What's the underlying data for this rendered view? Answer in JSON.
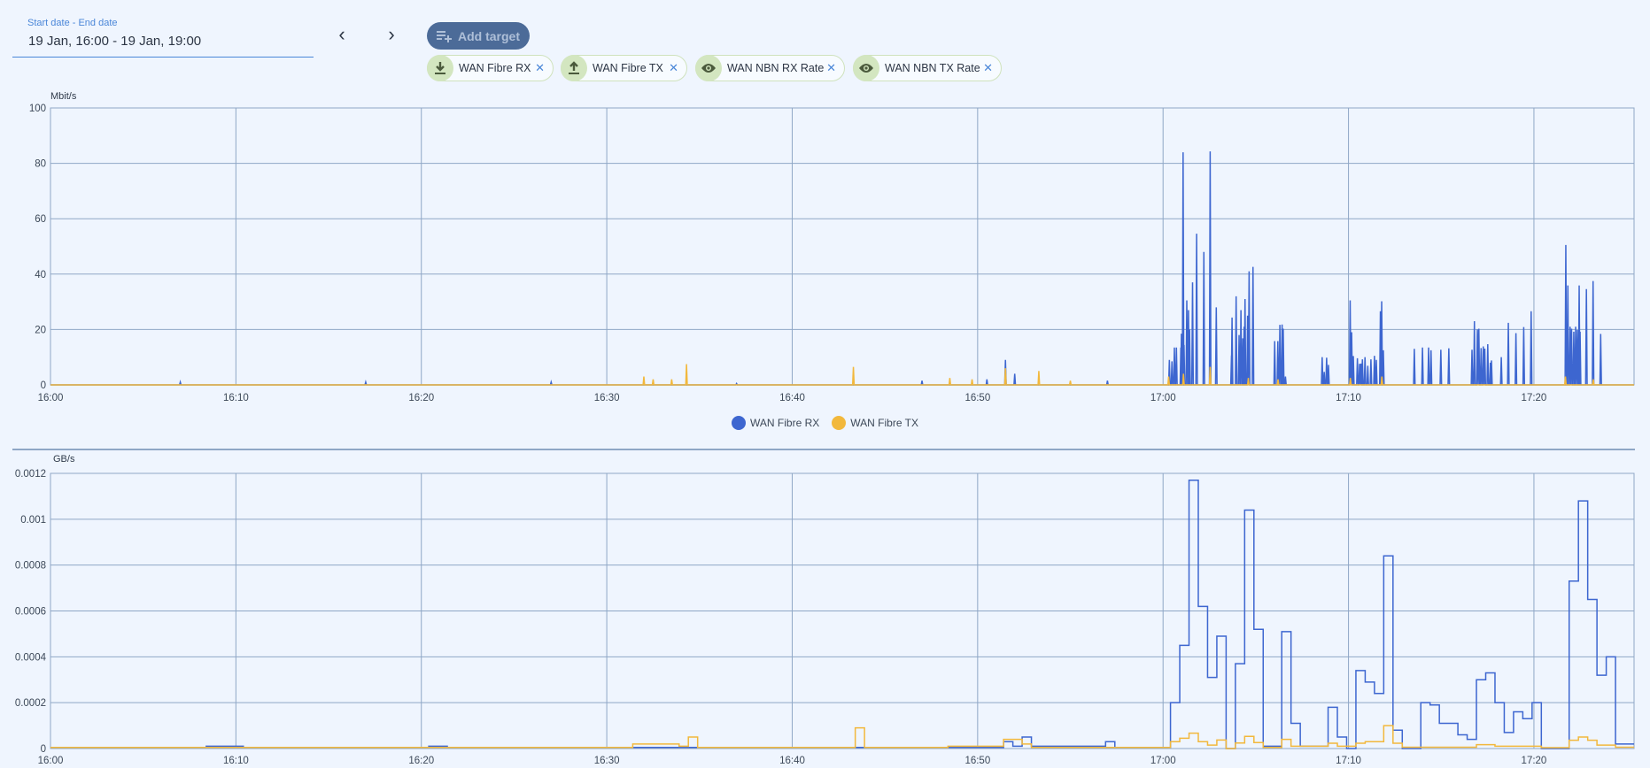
{
  "date_range": {
    "label": "Start date - End date",
    "value": "19 Jan, 16:00 - 19 Jan, 19:00"
  },
  "nav": {
    "prev": "‹",
    "next": "›"
  },
  "add_target": {
    "label": "Add target",
    "icon": "playlist-add-icon"
  },
  "chips": [
    {
      "label": "WAN Fibre RX",
      "icon": "download-icon"
    },
    {
      "label": "WAN Fibre TX",
      "icon": "upload-icon"
    },
    {
      "label": "WAN NBN RX Rate",
      "icon": "eye-icon"
    },
    {
      "label": "WAN NBN TX Rate",
      "icon": "eye-icon"
    }
  ],
  "chip_close": "✕",
  "colors": {
    "rx": "#3d66d0",
    "tx": "#f2b83c",
    "grid": "#8fa7c6"
  },
  "legend": [
    {
      "label": "WAN Fibre RX"
    },
    {
      "label": "WAN Fibre TX"
    }
  ],
  "chart_data": [
    {
      "type": "line",
      "ylabel": "Mbit/s",
      "ylim": [
        0,
        100
      ],
      "yticks": [
        "0",
        "20",
        "40",
        "60",
        "80",
        "100"
      ],
      "xlim_minutes_since_1600": [
        0,
        85.4
      ],
      "xticks": [
        "16:00",
        "16:10",
        "16:20",
        "16:30",
        "16:40",
        "16:50",
        "17:00",
        "17:10",
        "17:20"
      ],
      "grid": true,
      "legend_position": "bottom",
      "series": [
        {
          "name": "WAN Fibre RX",
          "spikes": [
            [
              7,
              1
            ],
            [
              17,
              1
            ],
            [
              27,
              1
            ],
            [
              37,
              0.5
            ],
            [
              47,
              1.5
            ],
            [
              50.5,
              2
            ],
            [
              51.5,
              9
            ],
            [
              52,
              4
            ],
            [
              57,
              1.5
            ],
            [
              60.34,
              9
            ],
            [
              60.48,
              8.5
            ],
            [
              60.61,
              13.5
            ],
            [
              60.72,
              13.5
            ],
            [
              60.96,
              13.5
            ],
            [
              60.99,
              18.5
            ],
            [
              61.08,
              84
            ],
            [
              61.13,
              14.4
            ],
            [
              61.28,
              30.5
            ],
            [
              61.37,
              27
            ],
            [
              61.43,
              20
            ],
            [
              61.59,
              37
            ],
            [
              61.81,
              54.6
            ],
            [
              62.2,
              48
            ],
            [
              62.54,
              84.3
            ],
            [
              62.87,
              28
            ],
            [
              63.69,
              10.6
            ],
            [
              63.72,
              24.3
            ],
            [
              63.94,
              32
            ],
            [
              64.1,
              18
            ],
            [
              64.2,
              27
            ],
            [
              64.3,
              16.8
            ],
            [
              64.37,
              21
            ],
            [
              64.42,
              31
            ],
            [
              64.56,
              25
            ],
            [
              64.64,
              41
            ],
            [
              64.85,
              42.6
            ],
            [
              66.02,
              15.8
            ],
            [
              66.19,
              15.8
            ],
            [
              66.3,
              21.7
            ],
            [
              66.42,
              21.8
            ],
            [
              66.48,
              20.3
            ],
            [
              66.6,
              3
            ],
            [
              68.58,
              10
            ],
            [
              68.69,
              4.7
            ],
            [
              68.82,
              9.8
            ],
            [
              68.92,
              7.2
            ],
            [
              70.09,
              30.5
            ],
            [
              70.17,
              19
            ],
            [
              70.26,
              10.4
            ],
            [
              70.48,
              9.6
            ],
            [
              70.6,
              7.6
            ],
            [
              70.68,
              7.7
            ],
            [
              70.75,
              9.2
            ],
            [
              70.89,
              10
            ],
            [
              71.04,
              6.9
            ],
            [
              71.21,
              9.2
            ],
            [
              71.4,
              10.5
            ],
            [
              71.5,
              9
            ],
            [
              71.72,
              26.6
            ],
            [
              71.79,
              30.2
            ],
            [
              71.88,
              12.5
            ],
            [
              73.55,
              13
            ],
            [
              73.99,
              13.5
            ],
            [
              74.32,
              13.5
            ],
            [
              74.45,
              12.5
            ],
            [
              74.98,
              12.7
            ],
            [
              75.41,
              13.2
            ],
            [
              76.66,
              12.7
            ],
            [
              76.79,
              23
            ],
            [
              76.95,
              20
            ],
            [
              77.03,
              20.3
            ],
            [
              77.15,
              13.3
            ],
            [
              77.27,
              13.9
            ],
            [
              77.35,
              13.1
            ],
            [
              77.51,
              14.7
            ],
            [
              77.65,
              8
            ],
            [
              77.71,
              8.8
            ],
            [
              78.24,
              10
            ],
            [
              78.62,
              22.4
            ],
            [
              79.03,
              18.7
            ],
            [
              79.45,
              20.9
            ],
            [
              79.85,
              26.6
            ],
            [
              81.72,
              50.5
            ],
            [
              81.83,
              35.9
            ],
            [
              81.95,
              21
            ],
            [
              82.03,
              20.3
            ],
            [
              82.15,
              19.2
            ],
            [
              82.25,
              21
            ],
            [
              82.34,
              19.8
            ],
            [
              82.44,
              35.9
            ],
            [
              82.49,
              19.2
            ],
            [
              82.83,
              34.6
            ],
            [
              83.19,
              37.5
            ],
            [
              83.6,
              18.4
            ]
          ]
        },
        {
          "name": "WAN Fibre TX",
          "spikes": [
            [
              32,
              3
            ],
            [
              32.5,
              2
            ],
            [
              33.5,
              2
            ],
            [
              34.3,
              7.5
            ],
            [
              43.3,
              6.5
            ],
            [
              48.5,
              2.5
            ],
            [
              49.7,
              2
            ],
            [
              51.5,
              6
            ],
            [
              53.3,
              5
            ],
            [
              55,
              1.5
            ],
            [
              60.3,
              3
            ],
            [
              61.1,
              4
            ],
            [
              62.54,
              6.5
            ],
            [
              64.6,
              2.5
            ],
            [
              66.2,
              2
            ],
            [
              70.1,
              2.5
            ],
            [
              71.8,
              3
            ],
            [
              81.7,
              3
            ],
            [
              83.2,
              2
            ]
          ]
        }
      ]
    },
    {
      "type": "line",
      "ylabel": "GB/s",
      "ylim": [
        0,
        0.0012
      ],
      "yticks": [
        "0",
        "0.0002",
        "0.0004",
        "0.0006",
        "0.0008",
        "0.001",
        "0.0012"
      ],
      "xlim_minutes_since_1600": [
        0,
        85.4
      ],
      "xticks": [
        "16:00",
        "16:10",
        "16:20",
        "16:30",
        "16:40",
        "16:50",
        "17:00",
        "17:10",
        "17:20"
      ],
      "grid": true,
      "step": "after",
      "bin_start_minutes": 60.4,
      "bin_width_minutes": 0.5,
      "series": [
        {
          "name": "WAN Fibre RX",
          "early_steps": [
            [
              0,
              5e-06
            ],
            [
              8.4,
              1e-05
            ],
            [
              10.4,
              5e-06
            ],
            [
              20.4,
              1e-05
            ],
            [
              21.4,
              5e-06
            ],
            [
              51.4,
              3e-05
            ],
            [
              51.9,
              1e-05
            ],
            [
              52.4,
              5e-05
            ],
            [
              52.9,
              1e-05
            ],
            [
              56.9,
              3e-05
            ],
            [
              57.4,
              5e-06
            ]
          ],
          "values": [
            0.0002,
            0.00045,
            0.00117,
            0.00062,
            0.00031,
            0.00049,
            0,
            0.00037,
            0.00104,
            0.00052,
            1e-05,
            1e-05,
            0.00051,
            0.00011,
            1e-05,
            1e-05,
            1e-05,
            0.00018,
            5e-05,
            0,
            0.00034,
            0.00029,
            0.00024,
            0.00084,
            8e-05,
            0,
            0,
            0.0002,
            0.00019,
            0.00011,
            0.00011,
            6e-05,
            4e-05,
            0.0003,
            0.00033,
            0.0002,
            7e-05,
            0.00016,
            0.00013,
            0.0002,
            0,
            0,
            0,
            0.00073,
            0.00108,
            0.00065,
            0.00032,
            0.0004,
            2e-05,
            2e-05
          ]
        },
        {
          "name": "WAN Fibre TX",
          "early_steps": [
            [
              0,
              5e-06
            ],
            [
              31.4,
              2e-05
            ],
            [
              33.9,
              1e-05
            ],
            [
              34.4,
              5e-05
            ],
            [
              34.9,
              5e-06
            ],
            [
              43.4,
              9e-05
            ],
            [
              43.9,
              5e-06
            ],
            [
              48.4,
              1e-05
            ],
            [
              49.9,
              1e-05
            ],
            [
              51.4,
              4e-05
            ],
            [
              52.4,
              2e-05
            ],
            [
              52.9,
              5e-06
            ]
          ],
          "values": [
            3e-05,
            4.5e-05,
            6.7e-05,
            3e-05,
            1.5e-05,
            3.7e-05,
            0,
            2.4e-05,
            5.3e-05,
            2.6e-05,
            5e-06,
            5e-06,
            4e-05,
            1e-05,
            1e-05,
            1e-05,
            1e-05,
            2.3e-05,
            1e-05,
            1e-05,
            2.3e-05,
            3e-05,
            3e-05,
            0.0001,
            2.3e-05,
            6e-06,
            6e-06,
            6e-06,
            6e-06,
            6e-06,
            6e-06,
            6e-06,
            6e-06,
            1.7e-05,
            1.7e-05,
            1e-05,
            1e-05,
            1e-05,
            1e-05,
            1e-05,
            4e-06,
            4e-06,
            4e-06,
            3.6e-05,
            5e-05,
            3.6e-05,
            1.5e-05,
            1.5e-05,
            6e-06,
            6e-06
          ]
        }
      ]
    }
  ]
}
